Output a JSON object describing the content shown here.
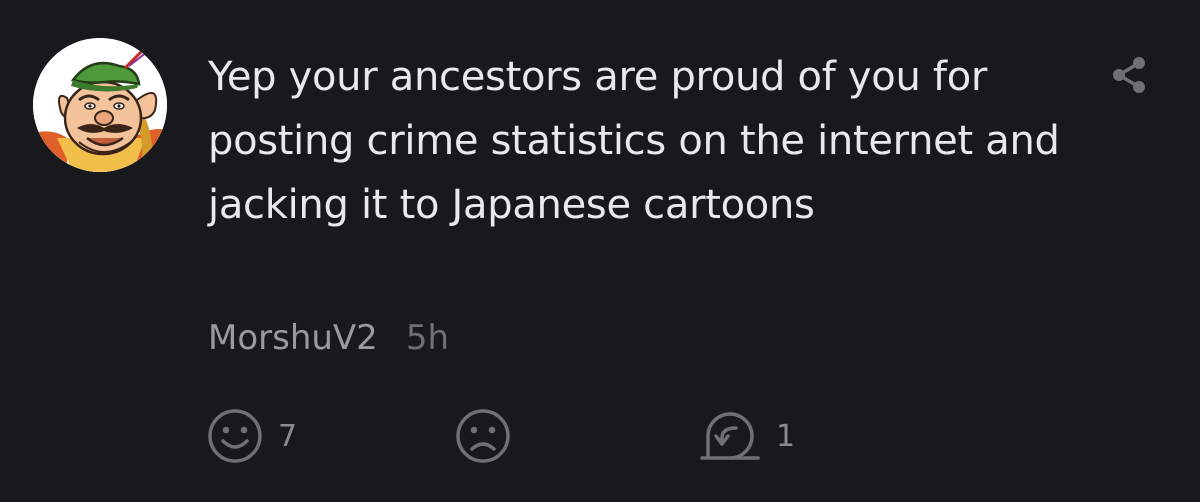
{
  "comment": {
    "text": "Yep your ancestors are proud of you for posting crime statistics on the internet and jacking it to Japanese cartoons",
    "author": "MorshuV2",
    "time": "5h"
  },
  "actions": {
    "like_icon": "smiley-face-icon",
    "like_count": "7",
    "dislike_icon": "frown-face-icon",
    "reply_icon": "reply-icon",
    "reply_count": "1"
  },
  "header": {
    "share_icon": "share-icon"
  },
  "colors": {
    "background": "#18181d",
    "text": "#e9e9ec",
    "author": "#9a9aa0",
    "muted": "#6f6f75"
  }
}
